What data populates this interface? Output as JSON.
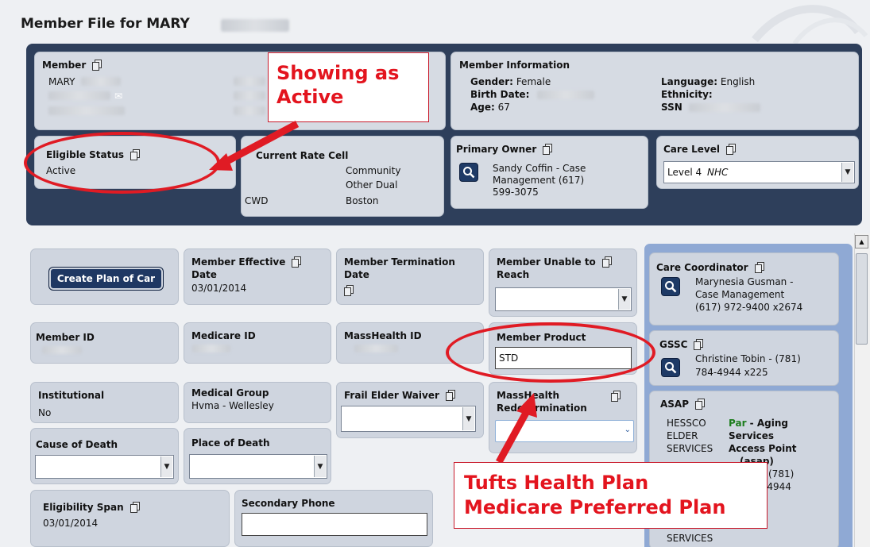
{
  "page": {
    "title": "Member File for MARY"
  },
  "member_card": {
    "label": "Member",
    "first_name": "MARY"
  },
  "member_info": {
    "title": "Member Information",
    "gender_label": "Gender:",
    "gender": "Female",
    "birth_label": "Birth Date:",
    "age_label": "Age:",
    "age": "67",
    "language_label": "Language:",
    "language": "English",
    "ethnicity_label": "Ethnicity:",
    "ssn_label": "SSN"
  },
  "eligible_status": {
    "label": "Eligible Status",
    "value": "Active"
  },
  "rate_cell": {
    "label": "Current Rate Cell",
    "line1": "Community",
    "line2": "Other Dual",
    "code": "CWD",
    "city": "Boston"
  },
  "primary_owner": {
    "label": "Primary Owner",
    "line1": "Sandy Coffin - Case",
    "line2": "Management (617)",
    "line3": "599-3075"
  },
  "care_level": {
    "label": "Care Level",
    "level": "Level 4",
    "suffix": "NHC"
  },
  "create_plan": {
    "label": "Create Plan of Car"
  },
  "member_effective": {
    "label1": "Member Effective",
    "label2": "Date",
    "value": "03/01/2014"
  },
  "member_termination": {
    "label1": "Member Termination",
    "label2": "Date"
  },
  "unable_to_reach": {
    "label1": "Member Unable to",
    "label2": "Reach"
  },
  "member_id": {
    "label": "Member ID"
  },
  "medicare_id": {
    "label": "Medicare ID"
  },
  "masshealth_id": {
    "label": "MassHealth ID"
  },
  "member_product": {
    "label": "Member Product",
    "value": "STD"
  },
  "institutional": {
    "label": "Institutional",
    "value": "No"
  },
  "medical_group": {
    "label": "Medical Group",
    "value": "Hvma - Wellesley"
  },
  "frail_elder": {
    "label": "Frail Elder Waiver"
  },
  "masshealth_redet": {
    "label1": "MassHealth",
    "label2": "Redetermination"
  },
  "cause_of_death": {
    "label": "Cause of Death"
  },
  "place_of_death": {
    "label": "Place of Death"
  },
  "eligibility_span": {
    "label": "Eligibility Span",
    "value": "03/01/2014"
  },
  "secondary_phone": {
    "label": "Secondary Phone",
    "value": ""
  },
  "care_coordinator": {
    "label": "Care Coordinator",
    "line1": "Marynesia Gusman -",
    "line2": "Case Management",
    "line3": "(617) 972-9400 x2674"
  },
  "gssc": {
    "label": "GSSC",
    "line1": "Christine Tobin -  (781)",
    "line2": "784-4944 x225"
  },
  "asap": {
    "label": "ASAP",
    "left1": "HESSCO",
    "left2": "ELDER",
    "left3": "SERVICES",
    "left4": "SERVICES",
    "par": "Par",
    "right1": " - Aging",
    "right2": "Services",
    "right3": "Access Point",
    "right4": "(asap)",
    "right5": "(781)",
    "right6": "-4944"
  },
  "annotations": {
    "showing_active": {
      "line1": "Showing as",
      "line2": "Active"
    },
    "tufts": {
      "line1": "Tufts Health Plan",
      "line2": "Medicare Preferred Plan"
    }
  },
  "colors": {
    "header_bg": "#2e3f5b",
    "card_bg": "#cfd5df",
    "annotation_red": "#e01b24",
    "right_panel": "#8fa9d4"
  }
}
